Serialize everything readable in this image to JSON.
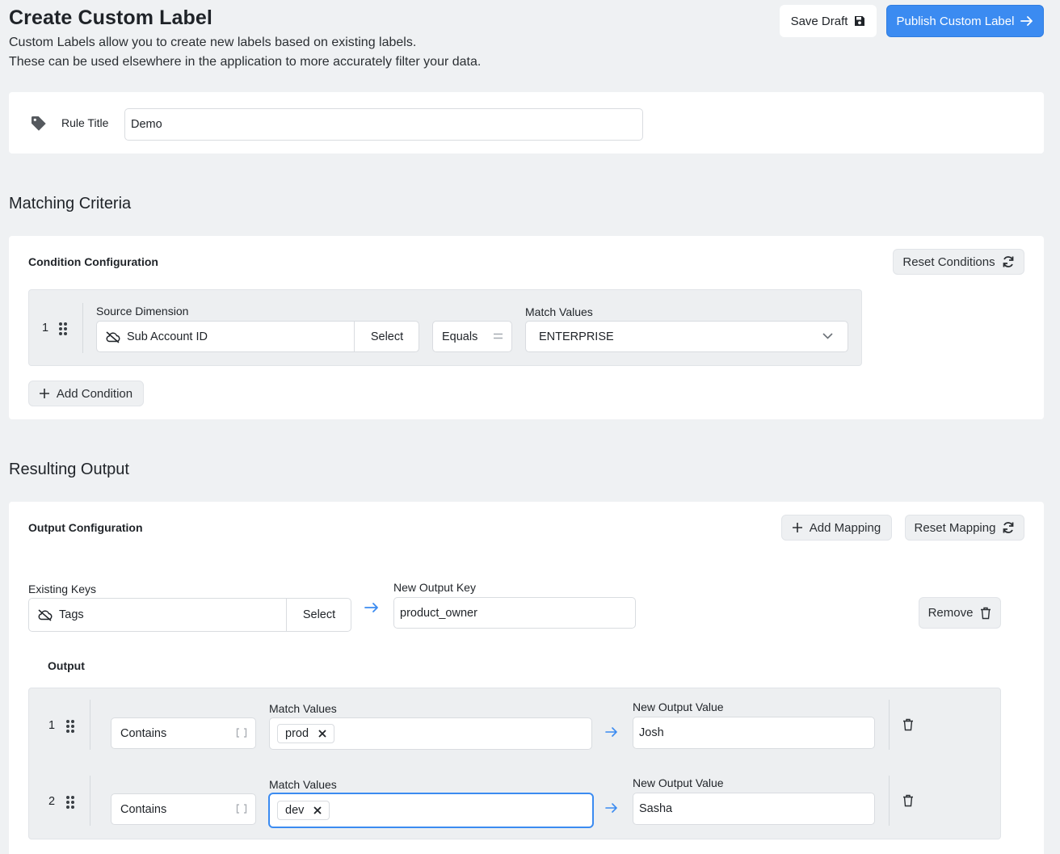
{
  "header": {
    "title": "Create Custom Label",
    "description_line1": "Custom Labels allow you to create new labels based on existing labels.",
    "description_line2": "These can be used elsewhere in the application to more accurately filter your data.",
    "save_draft_label": "Save Draft",
    "publish_label": "Publish Custom Label"
  },
  "rule": {
    "title_label": "Rule Title",
    "title_value": "Demo"
  },
  "matching": {
    "section_title": "Matching Criteria",
    "card_title": "Condition Configuration",
    "reset_label": "Reset Conditions",
    "conditions": [
      {
        "index": "1",
        "source_label": "Source Dimension",
        "source_value": "Sub Account ID",
        "select_label": "Select",
        "operator": "Equals",
        "match_label": "Match Values",
        "match_value": "ENTERPRISE"
      }
    ],
    "add_condition_label": "Add Condition"
  },
  "output": {
    "section_title": "Resulting Output",
    "card_title": "Output Configuration",
    "add_mapping_label": "Add Mapping",
    "reset_mapping_label": "Reset Mapping",
    "existing_keys_label": "Existing Keys",
    "existing_keys_value": "Tags",
    "select_label": "Select",
    "new_key_label": "New Output Key",
    "new_key_value": "product_owner",
    "remove_label": "Remove",
    "output_label": "Output",
    "rows": [
      {
        "index": "1",
        "operator": "Contains",
        "match_label": "Match Values",
        "chip": "prod",
        "value_label": "New Output Value",
        "value": "Josh"
      },
      {
        "index": "2",
        "operator": "Contains",
        "match_label": "Match Values",
        "chip": "dev",
        "value_label": "New Output Value",
        "value": "Sasha"
      }
    ]
  },
  "colors": {
    "accent": "#3b8bf1",
    "background": "#eff1f3",
    "panel": "#edeff1"
  },
  "icons": [
    "save-icon",
    "arrow-right-icon",
    "tag-icon",
    "refresh-icon",
    "cloud-icon",
    "equals-icon",
    "chevron-down-icon",
    "plus-icon",
    "trash-icon",
    "brackets-icon",
    "drag-handle-icon",
    "close-icon"
  ]
}
